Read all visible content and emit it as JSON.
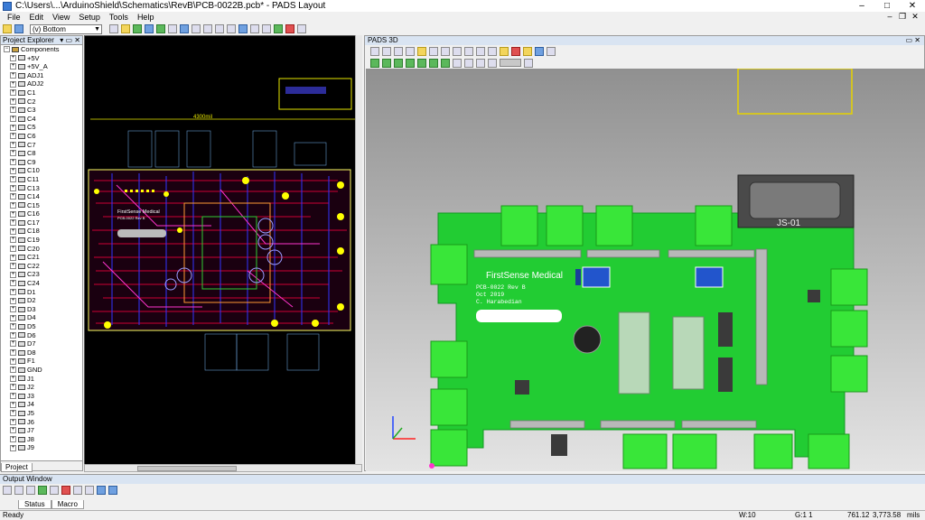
{
  "window": {
    "title": "C:\\Users\\...\\ArduinoShield\\Schematics\\RevB\\PCB-0022B.pcb* - PADS Layout"
  },
  "menu": [
    "File",
    "Edit",
    "View",
    "Setup",
    "Tools",
    "Help"
  ],
  "toolbar": {
    "layer_selected": "(v) Bottom"
  },
  "explorer": {
    "title": "Project Explorer",
    "root": "Components",
    "items": [
      "+5V",
      "+5V_A",
      "ADJ1",
      "ADJ2",
      "C1",
      "C2",
      "C3",
      "C4",
      "C5",
      "C6",
      "C7",
      "C8",
      "C9",
      "C10",
      "C11",
      "C13",
      "C14",
      "C15",
      "C16",
      "C17",
      "C18",
      "C19",
      "C20",
      "C21",
      "C22",
      "C23",
      "C24",
      "D1",
      "D2",
      "D3",
      "D4",
      "D5",
      "D6",
      "D7",
      "D8",
      "F1",
      "GND",
      "J1",
      "J2",
      "J3",
      "J4",
      "J5",
      "J6",
      "J7",
      "J8",
      "J9"
    ],
    "tab": "Project"
  },
  "pcb2d": {
    "board_text": "FirstSense Medical",
    "board_sub": "PCB-0022 Rev B",
    "dim_label": "4300mil"
  },
  "view3d": {
    "title": "PADS 3D",
    "brand": "FirstSense Medical",
    "part_number": "PCB-0022 Rev B",
    "date": "Oct 2019",
    "author": "C. Harabedian",
    "connector_text": "JS-01"
  },
  "output": {
    "title": "Output Window",
    "tabs": [
      "Status",
      "Macro"
    ]
  },
  "status": {
    "state": "Ready",
    "width": "W:10",
    "grid": "G:1 1",
    "x": "761.12",
    "y": "3,773.58",
    "units": "mils"
  },
  "colors": {
    "board_green": "#22cc33",
    "connector_green": "#39e639",
    "silk": "#ffffff",
    "pcb_bg": "#000000"
  }
}
